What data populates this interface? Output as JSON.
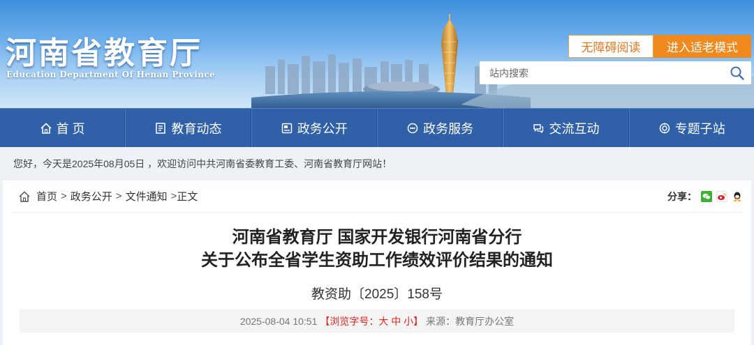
{
  "banner": {
    "title": "河南省教育厅",
    "subtitle": "Education Department Of Henan Province",
    "barrier_free_label": "无障碍阅读",
    "elder_mode_label": "进入适老模式",
    "search_placeholder": "站内搜索"
  },
  "nav": {
    "items": [
      {
        "label": "首 页",
        "icon": "home-icon"
      },
      {
        "label": "教育动态",
        "icon": "news-icon"
      },
      {
        "label": "政务公开",
        "icon": "document-icon"
      },
      {
        "label": "政务服务",
        "icon": "service-icon"
      },
      {
        "label": "交流互动",
        "icon": "chat-icon"
      },
      {
        "label": "专题子站",
        "icon": "topic-icon"
      }
    ]
  },
  "welcome": "您好，今天是2025年08月05日 ，欢迎访问中共河南省委教育工委、河南省教育厅网站！",
  "breadcrumb": [
    "首页",
    "政务公开",
    "文件通知",
    "正文"
  ],
  "breadcrumb_sep": ">",
  "share": {
    "label": "分享：",
    "icons": [
      "wechat-icon",
      "weibo-icon",
      "qq-icon"
    ]
  },
  "article": {
    "title_line1": "河南省教育厅 国家开发银行河南省分行",
    "title_line2": "关于公布全省学生资助工作绩效评价结果的通知",
    "doc_number": "教资助〔2025〕158号",
    "datetime": "2025-08-04 10:51",
    "font_size_label": "【浏览字号：大 中 小】",
    "source": "来源：教育厅办公室"
  },
  "colors": {
    "nav_bg": "#2f60a8",
    "accent_orange": "#f08a1f",
    "font_size_red": "#e0261d"
  }
}
